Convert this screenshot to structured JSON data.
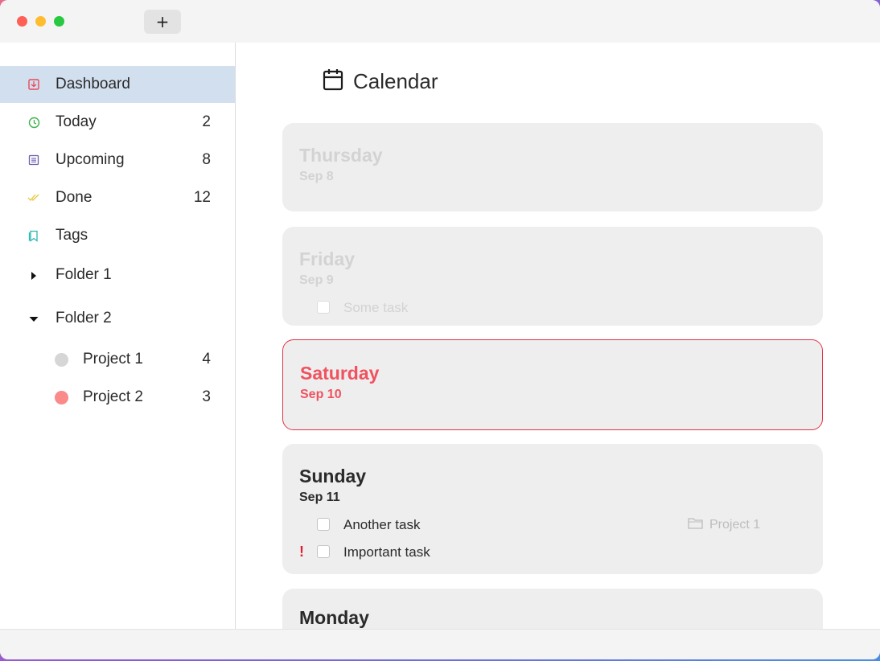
{
  "window": {
    "add_button_label": "+"
  },
  "sidebar": {
    "items": [
      {
        "label": "Dashboard",
        "count": "",
        "icon": "dashboard-icon",
        "color": "#e8485a"
      },
      {
        "label": "Today",
        "count": "2",
        "icon": "clock-icon",
        "color": "#3bb24a"
      },
      {
        "label": "Upcoming",
        "count": "8",
        "icon": "calendar-list-icon",
        "color": "#6b5fb0"
      },
      {
        "label": "Done",
        "count": "12",
        "icon": "double-check-icon",
        "color": "#e6c63a"
      },
      {
        "label": "Tags",
        "count": "",
        "icon": "bookmark-icon",
        "color": "#2bb8b0"
      }
    ],
    "folders": [
      {
        "label": "Folder 1",
        "expanded": false
      },
      {
        "label": "Folder 2",
        "expanded": true
      }
    ],
    "projects": [
      {
        "label": "Project 1",
        "count": "4",
        "color": "#d6d6d6"
      },
      {
        "label": "Project 2",
        "count": "3",
        "color": "#fb8a8a"
      }
    ]
  },
  "main": {
    "title": "Calendar",
    "days": [
      {
        "name": "Thursday",
        "date": "Sep 8",
        "state": "faded",
        "tasks": []
      },
      {
        "name": "Friday",
        "date": "Sep 9",
        "state": "faded",
        "tasks": [
          {
            "text": "Some task",
            "important": false,
            "project": ""
          }
        ]
      },
      {
        "name": "Saturday",
        "date": "Sep 10",
        "state": "selected",
        "tasks": []
      },
      {
        "name": "Sunday",
        "date": "Sep 11",
        "state": "normal",
        "tasks": [
          {
            "text": "Another task",
            "important": false,
            "project": "Project 1"
          },
          {
            "text": "Important task",
            "important": true,
            "project": "",
            "priority_mark": "!"
          }
        ]
      },
      {
        "name": "Monday",
        "date": "",
        "state": "normal",
        "tasks": []
      }
    ]
  }
}
